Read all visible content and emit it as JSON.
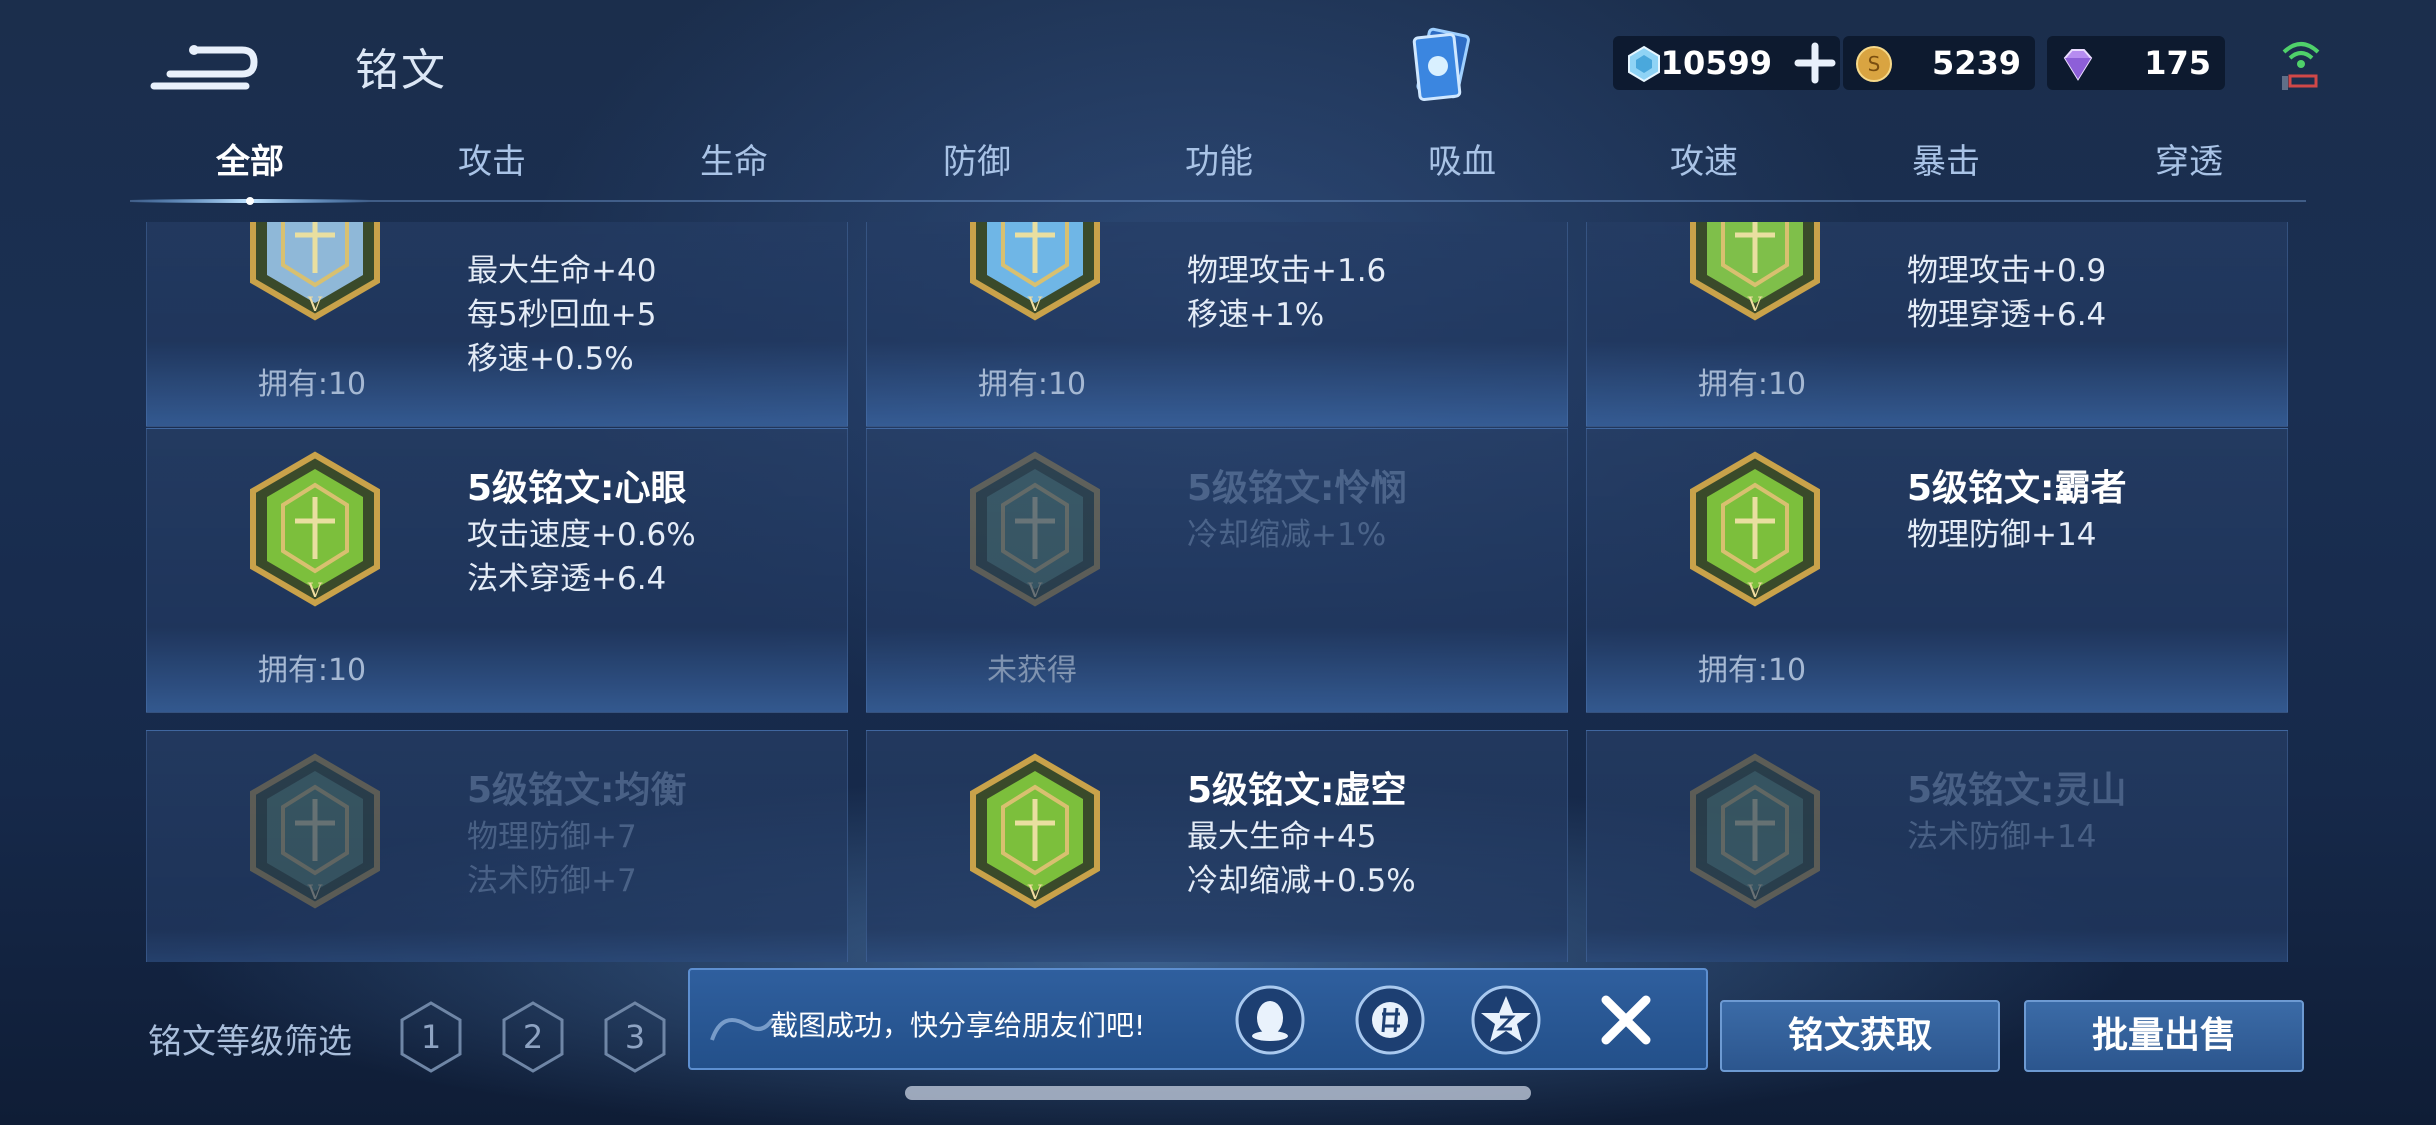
{
  "header": {
    "title": "铭文"
  },
  "resources": {
    "diamond": "10599",
    "gold": "5239",
    "gem": "175"
  },
  "tabs": [
    "全部",
    "攻击",
    "生命",
    "防御",
    "功能",
    "吸血",
    "攻速",
    "暴击",
    "穿透"
  ],
  "cards": [
    {
      "name": "",
      "attrs": [
        "最大生命+40",
        "每5秒回血+5",
        "移速+0.5%"
      ],
      "owned": "拥有:10",
      "locked": false,
      "color": "#8fb8d8"
    },
    {
      "name": "",
      "attrs": [
        "物理攻击+1.6",
        "移速+1%"
      ],
      "owned": "拥有:10",
      "locked": false,
      "color": "#6fb6e6"
    },
    {
      "name": "",
      "attrs": [
        "物理攻击+0.9",
        "物理穿透+6.4"
      ],
      "owned": "拥有:10",
      "locked": false,
      "color": "#7fbf4a"
    },
    {
      "name": "5级铭文:心眼",
      "attrs": [
        "攻击速度+0.6%",
        "法术穿透+6.4"
      ],
      "owned": "拥有:10",
      "locked": false,
      "color": "#7cbf3c"
    },
    {
      "name": "5级铭文:怜悯",
      "attrs": [
        "冷却缩减+1%"
      ],
      "owned": "未获得",
      "locked": true,
      "color": "#5f8a6a"
    },
    {
      "name": "5级铭文:霸者",
      "attrs": [
        "物理防御+14"
      ],
      "owned": "拥有:10",
      "locked": false,
      "color": "#7cbf3c"
    },
    {
      "name": "5级铭文:均衡",
      "attrs": [
        "物理防御+7",
        "法术防御+7"
      ],
      "owned": "",
      "locked": true,
      "color": "#5f8a6a"
    },
    {
      "name": "5级铭文:虚空",
      "attrs": [
        "最大生命+45",
        "冷却缩减+0.5%"
      ],
      "owned": "",
      "locked": false,
      "color": "#7cbf3c"
    },
    {
      "name": "5级铭文:灵山",
      "attrs": [
        "法术防御+14"
      ],
      "owned": "",
      "locked": true,
      "color": "#5f8a6a"
    }
  ],
  "filter": {
    "label": "铭文等级筛选",
    "levels": [
      "1",
      "2",
      "3"
    ]
  },
  "share": {
    "text": "截图成功，快分享给朋友们吧!"
  },
  "buttons": {
    "acquire": "铭文获取",
    "bulk_sell": "批量出售"
  },
  "colors": {
    "accent": "#5d8fd0",
    "emblem_gold": "#c9a24a"
  },
  "icons": [
    "back-arrow-icon",
    "card-deck-icon",
    "diamond-icon",
    "plus-icon",
    "gold-coin-icon",
    "gem-icon",
    "signal-icon",
    "qq-icon",
    "moments-icon",
    "qzone-icon",
    "close-icon"
  ]
}
